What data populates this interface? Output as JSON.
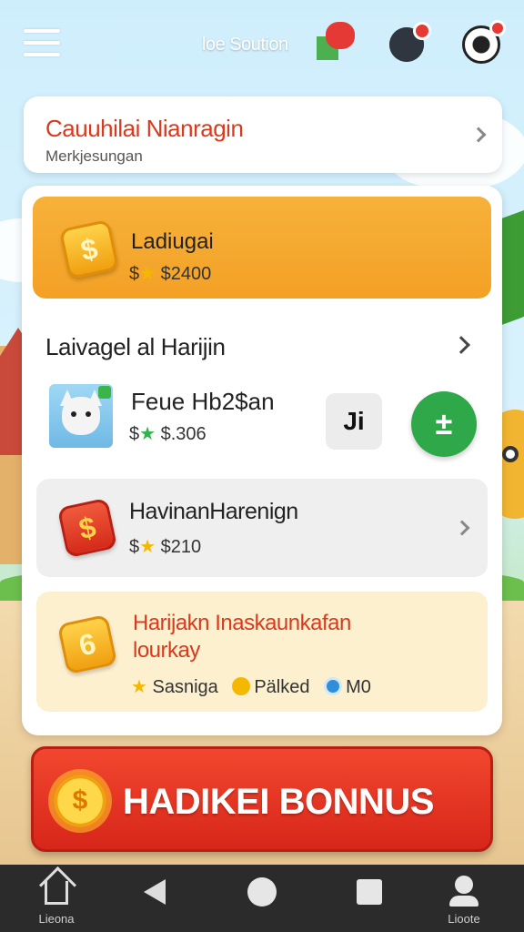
{
  "header": {
    "title": "loe Soution",
    "icons": [
      "menu-icon",
      "flag-icon",
      "gear-icon",
      "soccer-ball-icon"
    ]
  },
  "notification": {
    "title": "Cauuhilai Nianragin",
    "subtitle": "Merkjesungan"
  },
  "balance": {
    "label": "Ladiugai",
    "amount_prefix": "$",
    "amount": "$2400"
  },
  "section": {
    "title": "Laivagel al Harijin"
  },
  "pet_item": {
    "name": "Feue Hb2$an",
    "amount_prefix": "$",
    "amount": "$.306",
    "share_symbol": "Ji",
    "add_symbol": "±"
  },
  "row_item": {
    "name": "HavinanHarenign",
    "amount_prefix": "$",
    "amount": "$210"
  },
  "promo": {
    "title": "Harijakn Inaskaunkafan lourkay",
    "tags": [
      "Sasniga",
      "Pälked",
      "M0"
    ],
    "coin_symbol": "6"
  },
  "bonus_button": {
    "label": "HADIKEI BONNUS",
    "coin_symbol": "$"
  },
  "bottom_nav": {
    "items": [
      {
        "label": "Lieona",
        "icon": "home-icon"
      },
      {
        "label": "",
        "icon": "back-icon"
      },
      {
        "label": "",
        "icon": "home-circle-icon"
      },
      {
        "label": "",
        "icon": "recents-icon"
      },
      {
        "label": "Lioote",
        "icon": "profile-icon"
      }
    ]
  },
  "colors": {
    "accent_red": "#d93a1e",
    "balance_orange": "#f3a125",
    "add_green": "#2fa84a",
    "nav_bg": "#2b2b2b"
  }
}
